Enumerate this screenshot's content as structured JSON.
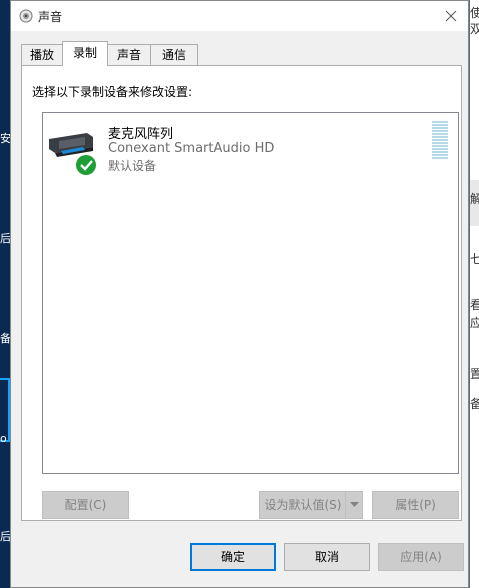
{
  "window": {
    "title": "声音"
  },
  "tabs": [
    {
      "label": "播放"
    },
    {
      "label": "录制"
    },
    {
      "label": "声音"
    },
    {
      "label": "通信"
    }
  ],
  "active_tab": "录制",
  "instruction": "选择以下录制设备来修改设置:",
  "devices": [
    {
      "name": "麦克风阵列",
      "driver": "Conexant SmartAudio HD",
      "status": "默认设备"
    }
  ],
  "level_meter": {
    "level": 0
  },
  "panel_buttons": {
    "configure": "配置(C)",
    "set_default": "设为默认值(S)",
    "properties": "属性(P)"
  },
  "dialog_buttons": {
    "ok": "确定",
    "cancel": "取消",
    "apply": "应用(A)"
  },
  "colors": {
    "accent": "#0078d7",
    "check_green": "#1e9e36",
    "meter": "#b6d9e6"
  }
}
